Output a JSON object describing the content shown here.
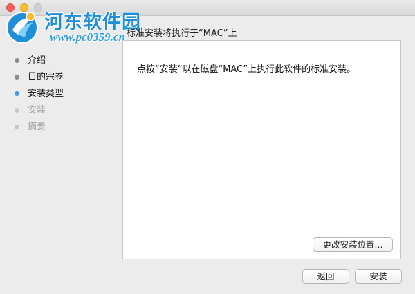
{
  "watermark": {
    "title": "河东软件园",
    "url": "www.pc0359.cn"
  },
  "heading": "标准安装将执行于“MAC”上",
  "steps": [
    {
      "label": "介绍",
      "state": "done"
    },
    {
      "label": "目的宗卷",
      "state": "done"
    },
    {
      "label": "安装类型",
      "state": "active"
    },
    {
      "label": "安装",
      "state": "pending"
    },
    {
      "label": "摘要",
      "state": "pending"
    }
  ],
  "content": {
    "message": "点按“安装”以在磁盘“MAC”上执行此软件的标准安装。",
    "change_location_label": "更改安装位置..."
  },
  "footer": {
    "back_label": "返回",
    "install_label": "安装"
  },
  "colors": {
    "active_step": "#3c9be0",
    "watermark": "#1e8fd8",
    "close": "#fc5f57",
    "minimize": "#fdbc2e"
  }
}
